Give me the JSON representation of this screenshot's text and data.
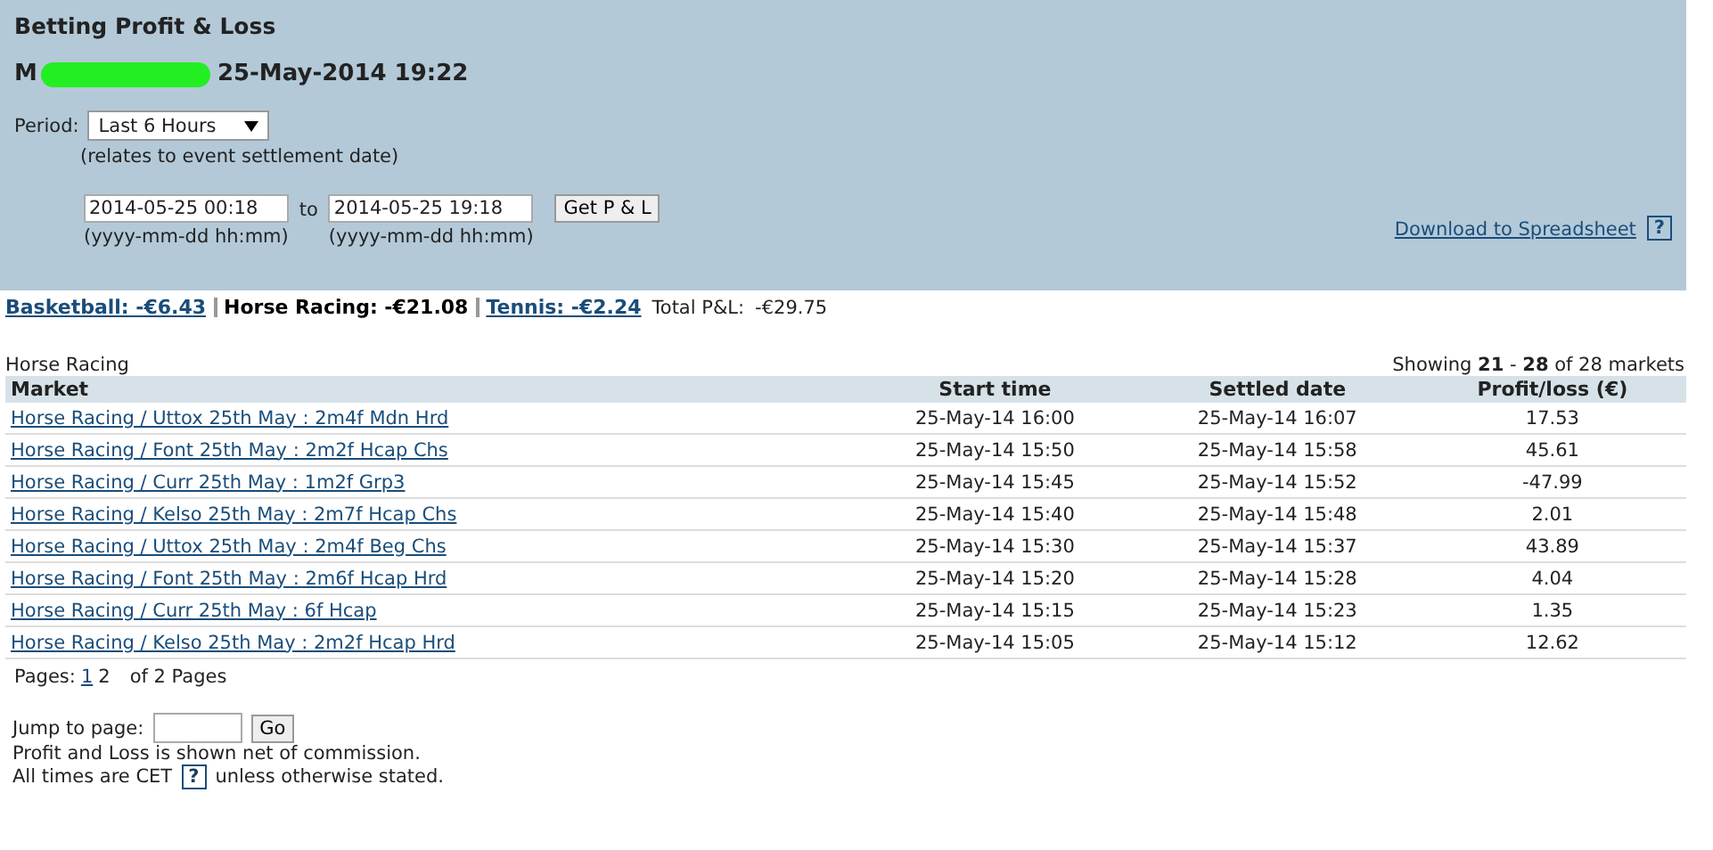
{
  "header": {
    "title": "Betting Profit & Loss",
    "account": "M",
    "timestamp": "25-May-2014 19:22",
    "period": {
      "label": "Period:",
      "value": "Last 6 Hours",
      "note": "(relates to event settlement date)"
    },
    "from": {
      "value": "2014-05-25 00:18",
      "hint": "(yyyy-mm-dd hh:mm)"
    },
    "to_label": "to",
    "to": {
      "value": "2014-05-25 19:18",
      "hint": "(yyyy-mm-dd hh:mm)"
    },
    "button": "Get P & L",
    "download": "Download to Spreadsheet",
    "help": "?"
  },
  "sports": [
    {
      "label": "Basketball: -€6.43",
      "selected": false
    },
    {
      "label": "Horse Racing: -€21.08",
      "selected": true
    },
    {
      "label": "Tennis: -€2.24",
      "selected": false
    }
  ],
  "total": {
    "label": "Total P&L:",
    "value": "-€29.75"
  },
  "section": "Horse Racing",
  "showing": "Showing **21** - **28** of 28 markets",
  "table": {
    "columns": [
      "Market",
      "Start time",
      "Settled date",
      "Profit/loss (€)"
    ],
    "rows": [
      [
        "Horse Racing / Uttox 25th May : 2m4f Mdn Hrd",
        "25-May-14 16:00",
        "25-May-14 16:07",
        "17.53"
      ],
      [
        "Horse Racing / Font 25th May : 2m2f Hcap Chs",
        "25-May-14 15:50",
        "25-May-14 15:58",
        "45.61"
      ],
      [
        "Horse Racing / Curr 25th May : 1m2f Grp3",
        "25-May-14 15:45",
        "25-May-14 15:52",
        "-47.99"
      ],
      [
        "Horse Racing / Kelso 25th May : 2m7f Hcap Chs",
        "25-May-14 15:40",
        "25-May-14 15:48",
        "2.01"
      ],
      [
        "Horse Racing / Uttox 25th May : 2m4f Beg Chs",
        "25-May-14 15:30",
        "25-May-14 15:37",
        "43.89"
      ],
      [
        "Horse Racing / Font 25th May : 2m6f Hcap Hrd",
        "25-May-14 15:20",
        "25-May-14 15:28",
        "4.04"
      ],
      [
        "Horse Racing / Curr 25th May : 6f Hcap",
        "25-May-14 15:15",
        "25-May-14 15:23",
        "1.35"
      ],
      [
        "Horse Racing / Kelso 25th May : 2m2f Hcap Hrd",
        "25-May-14 15:05",
        "25-May-14 15:12",
        "12.62"
      ]
    ]
  },
  "pagination": {
    "label": "Pages:",
    "pages": [
      {
        "label": "1",
        "selected": false
      },
      {
        "label": "2",
        "selected": true
      }
    ],
    "summary": "of 2 Pages"
  },
  "jump": {
    "label": "Jump to page:",
    "button": "Go"
  },
  "notes": [
    {
      "text": "Profit and Loss is shown net of commission."
    },
    {
      "text": "All times are CET",
      "help": "?",
      "after": "unless otherwise stated."
    }
  ]
}
